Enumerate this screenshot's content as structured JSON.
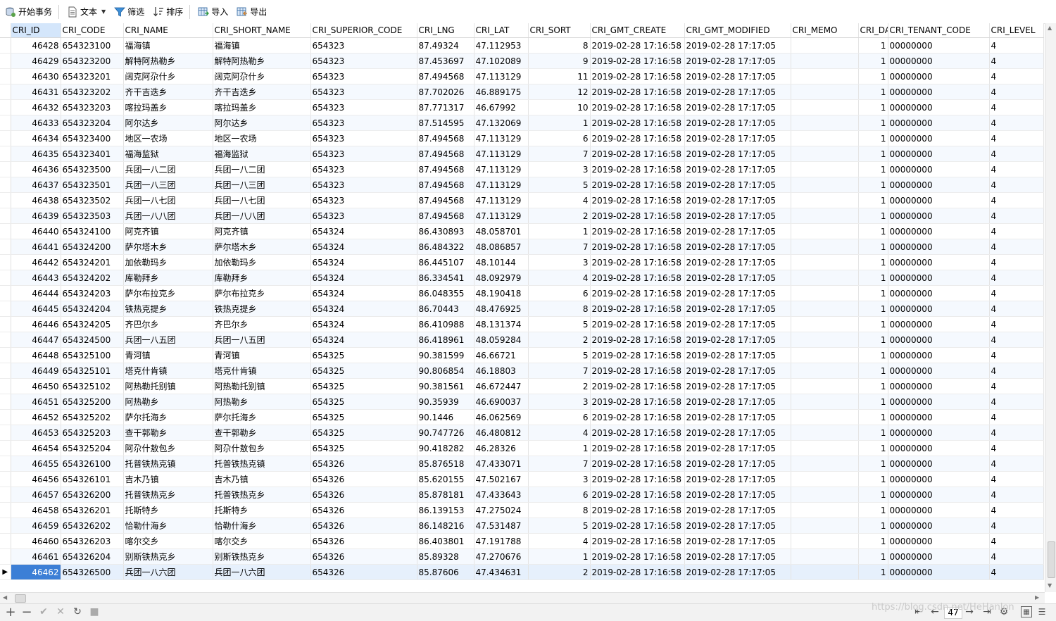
{
  "toolbar": {
    "begin_transaction": "开始事务",
    "text": "文本",
    "filter": "筛选",
    "sort": "排序",
    "import": "导入",
    "export": "导出"
  },
  "columns": [
    "CRI_ID",
    "CRI_CODE",
    "CRI_NAME",
    "CRI_SHORT_NAME",
    "CRI_SUPERIOR_CODE",
    "CRI_LNG",
    "CRI_LAT",
    "CRI_SORT",
    "CRI_GMT_CREATE",
    "CRI_GMT_MODIFIED",
    "CRI_MEMO",
    "CRI_DA",
    "CRI_TENANT_CODE",
    "CRI_LEVEL"
  ],
  "rows": [
    [
      "46428",
      "654323100",
      "福海镇",
      "福海镇",
      "654323",
      "87.49324",
      "47.112953",
      "8",
      "2019-02-28 17:16:58",
      "2019-02-28 17:17:05",
      "",
      "1",
      "00000000",
      "4"
    ],
    [
      "46429",
      "654323200",
      "解特阿热勒乡",
      "解特阿热勒乡",
      "654323",
      "87.453697",
      "47.102089",
      "9",
      "2019-02-28 17:16:58",
      "2019-02-28 17:17:05",
      "",
      "1",
      "00000000",
      "4"
    ],
    [
      "46430",
      "654323201",
      "阔克阿尕什乡",
      "阔克阿尕什乡",
      "654323",
      "87.494568",
      "47.113129",
      "11",
      "2019-02-28 17:16:58",
      "2019-02-28 17:17:05",
      "",
      "1",
      "00000000",
      "4"
    ],
    [
      "46431",
      "654323202",
      "齐干吉迭乡",
      "齐干吉迭乡",
      "654323",
      "87.702026",
      "46.889175",
      "12",
      "2019-02-28 17:16:58",
      "2019-02-28 17:17:05",
      "",
      "1",
      "00000000",
      "4"
    ],
    [
      "46432",
      "654323203",
      "喀拉玛盖乡",
      "喀拉玛盖乡",
      "654323",
      "87.771317",
      "46.67992",
      "10",
      "2019-02-28 17:16:58",
      "2019-02-28 17:17:05",
      "",
      "1",
      "00000000",
      "4"
    ],
    [
      "46433",
      "654323204",
      "阿尔达乡",
      "阿尔达乡",
      "654323",
      "87.514595",
      "47.132069",
      "1",
      "2019-02-28 17:16:58",
      "2019-02-28 17:17:05",
      "",
      "1",
      "00000000",
      "4"
    ],
    [
      "46434",
      "654323400",
      "地区一农场",
      "地区一农场",
      "654323",
      "87.494568",
      "47.113129",
      "6",
      "2019-02-28 17:16:58",
      "2019-02-28 17:17:05",
      "",
      "1",
      "00000000",
      "4"
    ],
    [
      "46435",
      "654323401",
      "福海监狱",
      "福海监狱",
      "654323",
      "87.494568",
      "47.113129",
      "7",
      "2019-02-28 17:16:58",
      "2019-02-28 17:17:05",
      "",
      "1",
      "00000000",
      "4"
    ],
    [
      "46436",
      "654323500",
      "兵团一八二团",
      "兵团一八二团",
      "654323",
      "87.494568",
      "47.113129",
      "3",
      "2019-02-28 17:16:58",
      "2019-02-28 17:17:05",
      "",
      "1",
      "00000000",
      "4"
    ],
    [
      "46437",
      "654323501",
      "兵团一八三团",
      "兵团一八三团",
      "654323",
      "87.494568",
      "47.113129",
      "5",
      "2019-02-28 17:16:58",
      "2019-02-28 17:17:05",
      "",
      "1",
      "00000000",
      "4"
    ],
    [
      "46438",
      "654323502",
      "兵团一八七团",
      "兵团一八七团",
      "654323",
      "87.494568",
      "47.113129",
      "4",
      "2019-02-28 17:16:58",
      "2019-02-28 17:17:05",
      "",
      "1",
      "00000000",
      "4"
    ],
    [
      "46439",
      "654323503",
      "兵团一八八团",
      "兵团一八八团",
      "654323",
      "87.494568",
      "47.113129",
      "2",
      "2019-02-28 17:16:58",
      "2019-02-28 17:17:05",
      "",
      "1",
      "00000000",
      "4"
    ],
    [
      "46440",
      "654324100",
      "阿克齐镇",
      "阿克齐镇",
      "654324",
      "86.430893",
      "48.058701",
      "1",
      "2019-02-28 17:16:58",
      "2019-02-28 17:17:05",
      "",
      "1",
      "00000000",
      "4"
    ],
    [
      "46441",
      "654324200",
      "萨尔塔木乡",
      "萨尔塔木乡",
      "654324",
      "86.484322",
      "48.086857",
      "7",
      "2019-02-28 17:16:58",
      "2019-02-28 17:17:05",
      "",
      "1",
      "00000000",
      "4"
    ],
    [
      "46442",
      "654324201",
      "加依勒玛乡",
      "加依勒玛乡",
      "654324",
      "86.445107",
      "48.10144",
      "3",
      "2019-02-28 17:16:58",
      "2019-02-28 17:17:05",
      "",
      "1",
      "00000000",
      "4"
    ],
    [
      "46443",
      "654324202",
      "库勒拜乡",
      "库勒拜乡",
      "654324",
      "86.334541",
      "48.092979",
      "4",
      "2019-02-28 17:16:58",
      "2019-02-28 17:17:05",
      "",
      "1",
      "00000000",
      "4"
    ],
    [
      "46444",
      "654324203",
      "萨尔布拉克乡",
      "萨尔布拉克乡",
      "654324",
      "86.048355",
      "48.190418",
      "6",
      "2019-02-28 17:16:58",
      "2019-02-28 17:17:05",
      "",
      "1",
      "00000000",
      "4"
    ],
    [
      "46445",
      "654324204",
      "铁热克提乡",
      "铁热克提乡",
      "654324",
      "86.70443",
      "48.476925",
      "8",
      "2019-02-28 17:16:58",
      "2019-02-28 17:17:05",
      "",
      "1",
      "00000000",
      "4"
    ],
    [
      "46446",
      "654324205",
      "齐巴尔乡",
      "齐巴尔乡",
      "654324",
      "86.410988",
      "48.131374",
      "5",
      "2019-02-28 17:16:58",
      "2019-02-28 17:17:05",
      "",
      "1",
      "00000000",
      "4"
    ],
    [
      "46447",
      "654324500",
      "兵团一八五团",
      "兵团一八五团",
      "654324",
      "86.418961",
      "48.059284",
      "2",
      "2019-02-28 17:16:58",
      "2019-02-28 17:17:05",
      "",
      "1",
      "00000000",
      "4"
    ],
    [
      "46448",
      "654325100",
      "青河镇",
      "青河镇",
      "654325",
      "90.381599",
      "46.66721",
      "5",
      "2019-02-28 17:16:58",
      "2019-02-28 17:17:05",
      "",
      "1",
      "00000000",
      "4"
    ],
    [
      "46449",
      "654325101",
      "塔克什肯镇",
      "塔克什肯镇",
      "654325",
      "90.806854",
      "46.18803",
      "7",
      "2019-02-28 17:16:58",
      "2019-02-28 17:17:05",
      "",
      "1",
      "00000000",
      "4"
    ],
    [
      "46450",
      "654325102",
      "阿热勒托别镇",
      "阿热勒托别镇",
      "654325",
      "90.381561",
      "46.672447",
      "2",
      "2019-02-28 17:16:58",
      "2019-02-28 17:17:05",
      "",
      "1",
      "00000000",
      "4"
    ],
    [
      "46451",
      "654325200",
      "阿热勒乡",
      "阿热勒乡",
      "654325",
      "90.35939",
      "46.690037",
      "3",
      "2019-02-28 17:16:58",
      "2019-02-28 17:17:05",
      "",
      "1",
      "00000000",
      "4"
    ],
    [
      "46452",
      "654325202",
      "萨尔托海乡",
      "萨尔托海乡",
      "654325",
      "90.1446",
      "46.062569",
      "6",
      "2019-02-28 17:16:58",
      "2019-02-28 17:17:05",
      "",
      "1",
      "00000000",
      "4"
    ],
    [
      "46453",
      "654325203",
      "查干郭勒乡",
      "查干郭勒乡",
      "654325",
      "90.747726",
      "46.480812",
      "4",
      "2019-02-28 17:16:58",
      "2019-02-28 17:17:05",
      "",
      "1",
      "00000000",
      "4"
    ],
    [
      "46454",
      "654325204",
      "阿尕什敖包乡",
      "阿尕什敖包乡",
      "654325",
      "90.418282",
      "46.28326",
      "1",
      "2019-02-28 17:16:58",
      "2019-02-28 17:17:05",
      "",
      "1",
      "00000000",
      "4"
    ],
    [
      "46455",
      "654326100",
      "托普铁热克镇",
      "托普铁热克镇",
      "654326",
      "85.876518",
      "47.433071",
      "7",
      "2019-02-28 17:16:58",
      "2019-02-28 17:17:05",
      "",
      "1",
      "00000000",
      "4"
    ],
    [
      "46456",
      "654326101",
      "吉木乃镇",
      "吉木乃镇",
      "654326",
      "85.620155",
      "47.502167",
      "3",
      "2019-02-28 17:16:58",
      "2019-02-28 17:17:05",
      "",
      "1",
      "00000000",
      "4"
    ],
    [
      "46457",
      "654326200",
      "托普铁热克乡",
      "托普铁热克乡",
      "654326",
      "85.878181",
      "47.433643",
      "6",
      "2019-02-28 17:16:58",
      "2019-02-28 17:17:05",
      "",
      "1",
      "00000000",
      "4"
    ],
    [
      "46458",
      "654326201",
      "托斯特乡",
      "托斯特乡",
      "654326",
      "86.139153",
      "47.275024",
      "8",
      "2019-02-28 17:16:58",
      "2019-02-28 17:17:05",
      "",
      "1",
      "00000000",
      "4"
    ],
    [
      "46459",
      "654326202",
      "恰勒什海乡",
      "恰勒什海乡",
      "654326",
      "86.148216",
      "47.531487",
      "5",
      "2019-02-28 17:16:58",
      "2019-02-28 17:17:05",
      "",
      "1",
      "00000000",
      "4"
    ],
    [
      "46460",
      "654326203",
      "喀尔交乡",
      "喀尔交乡",
      "654326",
      "86.403801",
      "47.191788",
      "4",
      "2019-02-28 17:16:58",
      "2019-02-28 17:17:05",
      "",
      "1",
      "00000000",
      "4"
    ],
    [
      "46461",
      "654326204",
      "别斯铁热克乡",
      "别斯铁热克乡",
      "654326",
      "85.89328",
      "47.270676",
      "1",
      "2019-02-28 17:16:58",
      "2019-02-28 17:17:05",
      "",
      "1",
      "00000000",
      "4"
    ],
    [
      "46462",
      "654326500",
      "兵团一八六团",
      "兵团一八六团",
      "654326",
      "85.87606",
      "47.434631",
      "2",
      "2019-02-28 17:16:58",
      "2019-02-28 17:17:05",
      "",
      "1",
      "00000000",
      "4"
    ]
  ],
  "numeric_columns": [
    0,
    5,
    6,
    7,
    11
  ],
  "selected_row": 34,
  "status": {
    "page_number": "47"
  },
  "watermark": "https://blog.csdn.net/HeHanlon"
}
